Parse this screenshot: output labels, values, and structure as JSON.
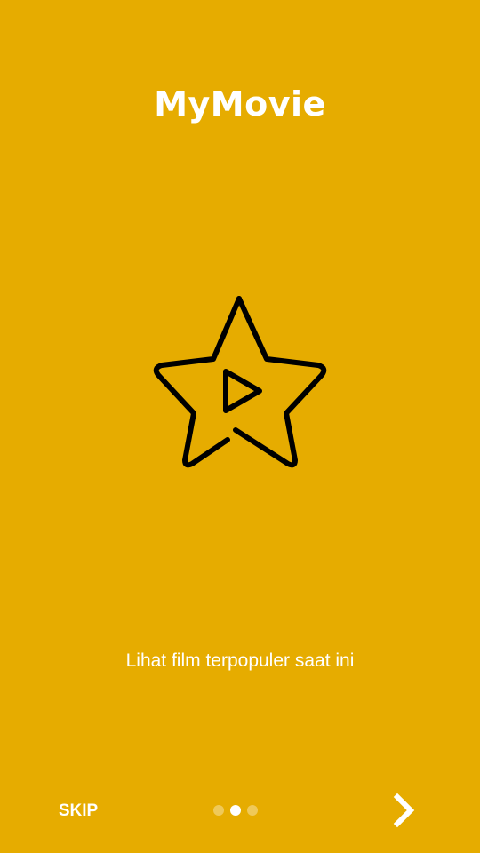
{
  "app": {
    "title": "MyMovie"
  },
  "onboarding": {
    "message": "Lihat film terpopuler saat ini",
    "icon": "star-play-icon",
    "pages_total": 3,
    "active_page": 2
  },
  "footer": {
    "skip_label": "SKIP",
    "next_icon": "chevron-right-icon"
  },
  "colors": {
    "background": "#E6AC00",
    "text": "#FFFFFF",
    "icon_stroke": "#000000",
    "dot_inactive": "rgba(255,255,255,0.35)",
    "dot_active": "#FFFFFF"
  }
}
